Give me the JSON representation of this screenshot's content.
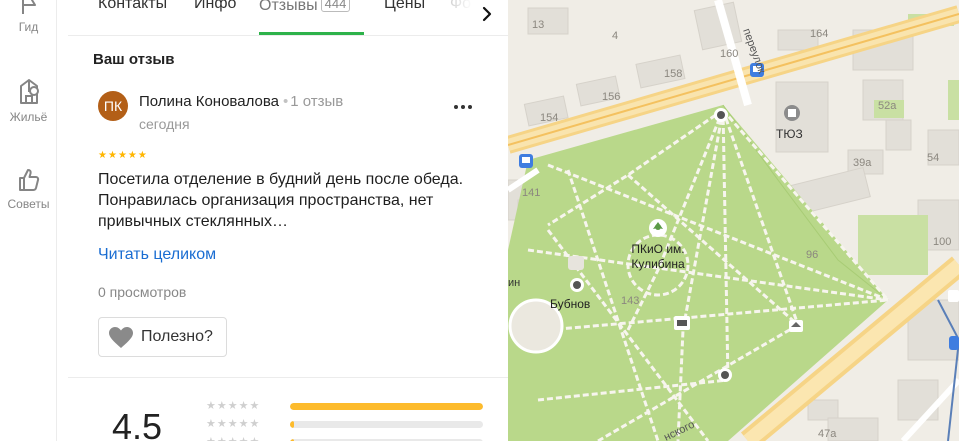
{
  "sidebar": {
    "items": [
      {
        "label": "Гид",
        "icon": "flag-icon"
      },
      {
        "label": "Жильё",
        "icon": "building-icon"
      },
      {
        "label": "Советы",
        "icon": "thumbs-up-icon"
      }
    ]
  },
  "tabs": {
    "items": [
      {
        "label": "Контакты"
      },
      {
        "label": "Инфо"
      },
      {
        "label": "Отзывы",
        "count": "444",
        "active": true
      },
      {
        "label": "Цены"
      },
      {
        "label": "Фо"
      }
    ]
  },
  "review": {
    "section_title": "Ваш отзыв",
    "avatar_initials": "ПК",
    "avatar_color": "#b35f17",
    "author": "Полина Коновалова",
    "author_reviews": "1 отзыв",
    "date": "сегодня",
    "rating": 5,
    "text": "Посетила отделение в будний день после обеда. Понравилась организация пространства, нет привычных стеклянных…",
    "read_more": "Читать целиком",
    "views": "0 просмотров",
    "useful_label": "Полезно?"
  },
  "summary": {
    "rating": "4.5",
    "bars": [
      {
        "stars": 5,
        "fraction": 1.0
      },
      {
        "stars": 4,
        "fraction": 0.02
      },
      {
        "stars": 3,
        "fraction": 0.02
      }
    ],
    "bar_color": "#fdbb2c"
  },
  "map": {
    "labels": {
      "park": "ПКиО им. Кулибина",
      "park_line1": "ПКиО им.",
      "park_line2": "Кулибина",
      "theater": "ТЮЗ",
      "bubnov": "Бубнов",
      "lane": "переулок",
      "street": "нского",
      "street_left": "ин"
    },
    "house_numbers": [
      "13",
      "4",
      "160",
      "164",
      "158",
      "156",
      "154",
      "52а",
      "54",
      "39а",
      "141",
      "100",
      "96",
      "143",
      "47а"
    ]
  }
}
